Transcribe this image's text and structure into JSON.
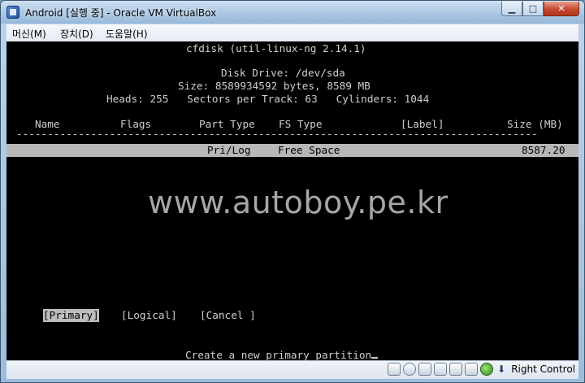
{
  "window": {
    "title": "Android [실행 중] - Oracle VM VirtualBox",
    "minimize_label": "▁",
    "maximize_label": "□",
    "close_label": "✕"
  },
  "menu": {
    "items": [
      {
        "label": "머신(M)"
      },
      {
        "label": "장치(D)"
      },
      {
        "label": "도움말(H)"
      }
    ]
  },
  "terminal": {
    "header": "cfdisk (util-linux-ng 2.14.1)",
    "disk_drive": "Disk Drive: /dev/sda",
    "size": "Size: 8589934592 bytes, 8589 MB",
    "geometry": "Heads: 255   Sectors per Track: 63   Cylinders: 1044",
    "columns": {
      "name": "Name",
      "flags": "Flags",
      "part_type": "Part Type",
      "fs_type": "FS Type",
      "label": "[Label]",
      "size": "Size (MB)"
    },
    "separator": "------------------------------------------------------------------------------------",
    "rows": [
      {
        "part_type": "Pri/Log",
        "fs_type": "Free Space",
        "size": "8587.20"
      }
    ],
    "buttons": [
      {
        "label": "[Primary]",
        "selected": true
      },
      {
        "label": "[Logical]",
        "selected": false
      },
      {
        "label": "[Cancel ]",
        "selected": false
      }
    ],
    "status_message": "Create a new primary partition"
  },
  "watermark": "www.autoboy.pe.kr",
  "statusbar": {
    "host_key": "Right Control",
    "icons": [
      "hdd-icon",
      "cd-icon",
      "usb-icon",
      "network-icon",
      "shared-folder-icon",
      "display-icon",
      "mouse-integration-icon",
      "host-key-icon"
    ]
  }
}
